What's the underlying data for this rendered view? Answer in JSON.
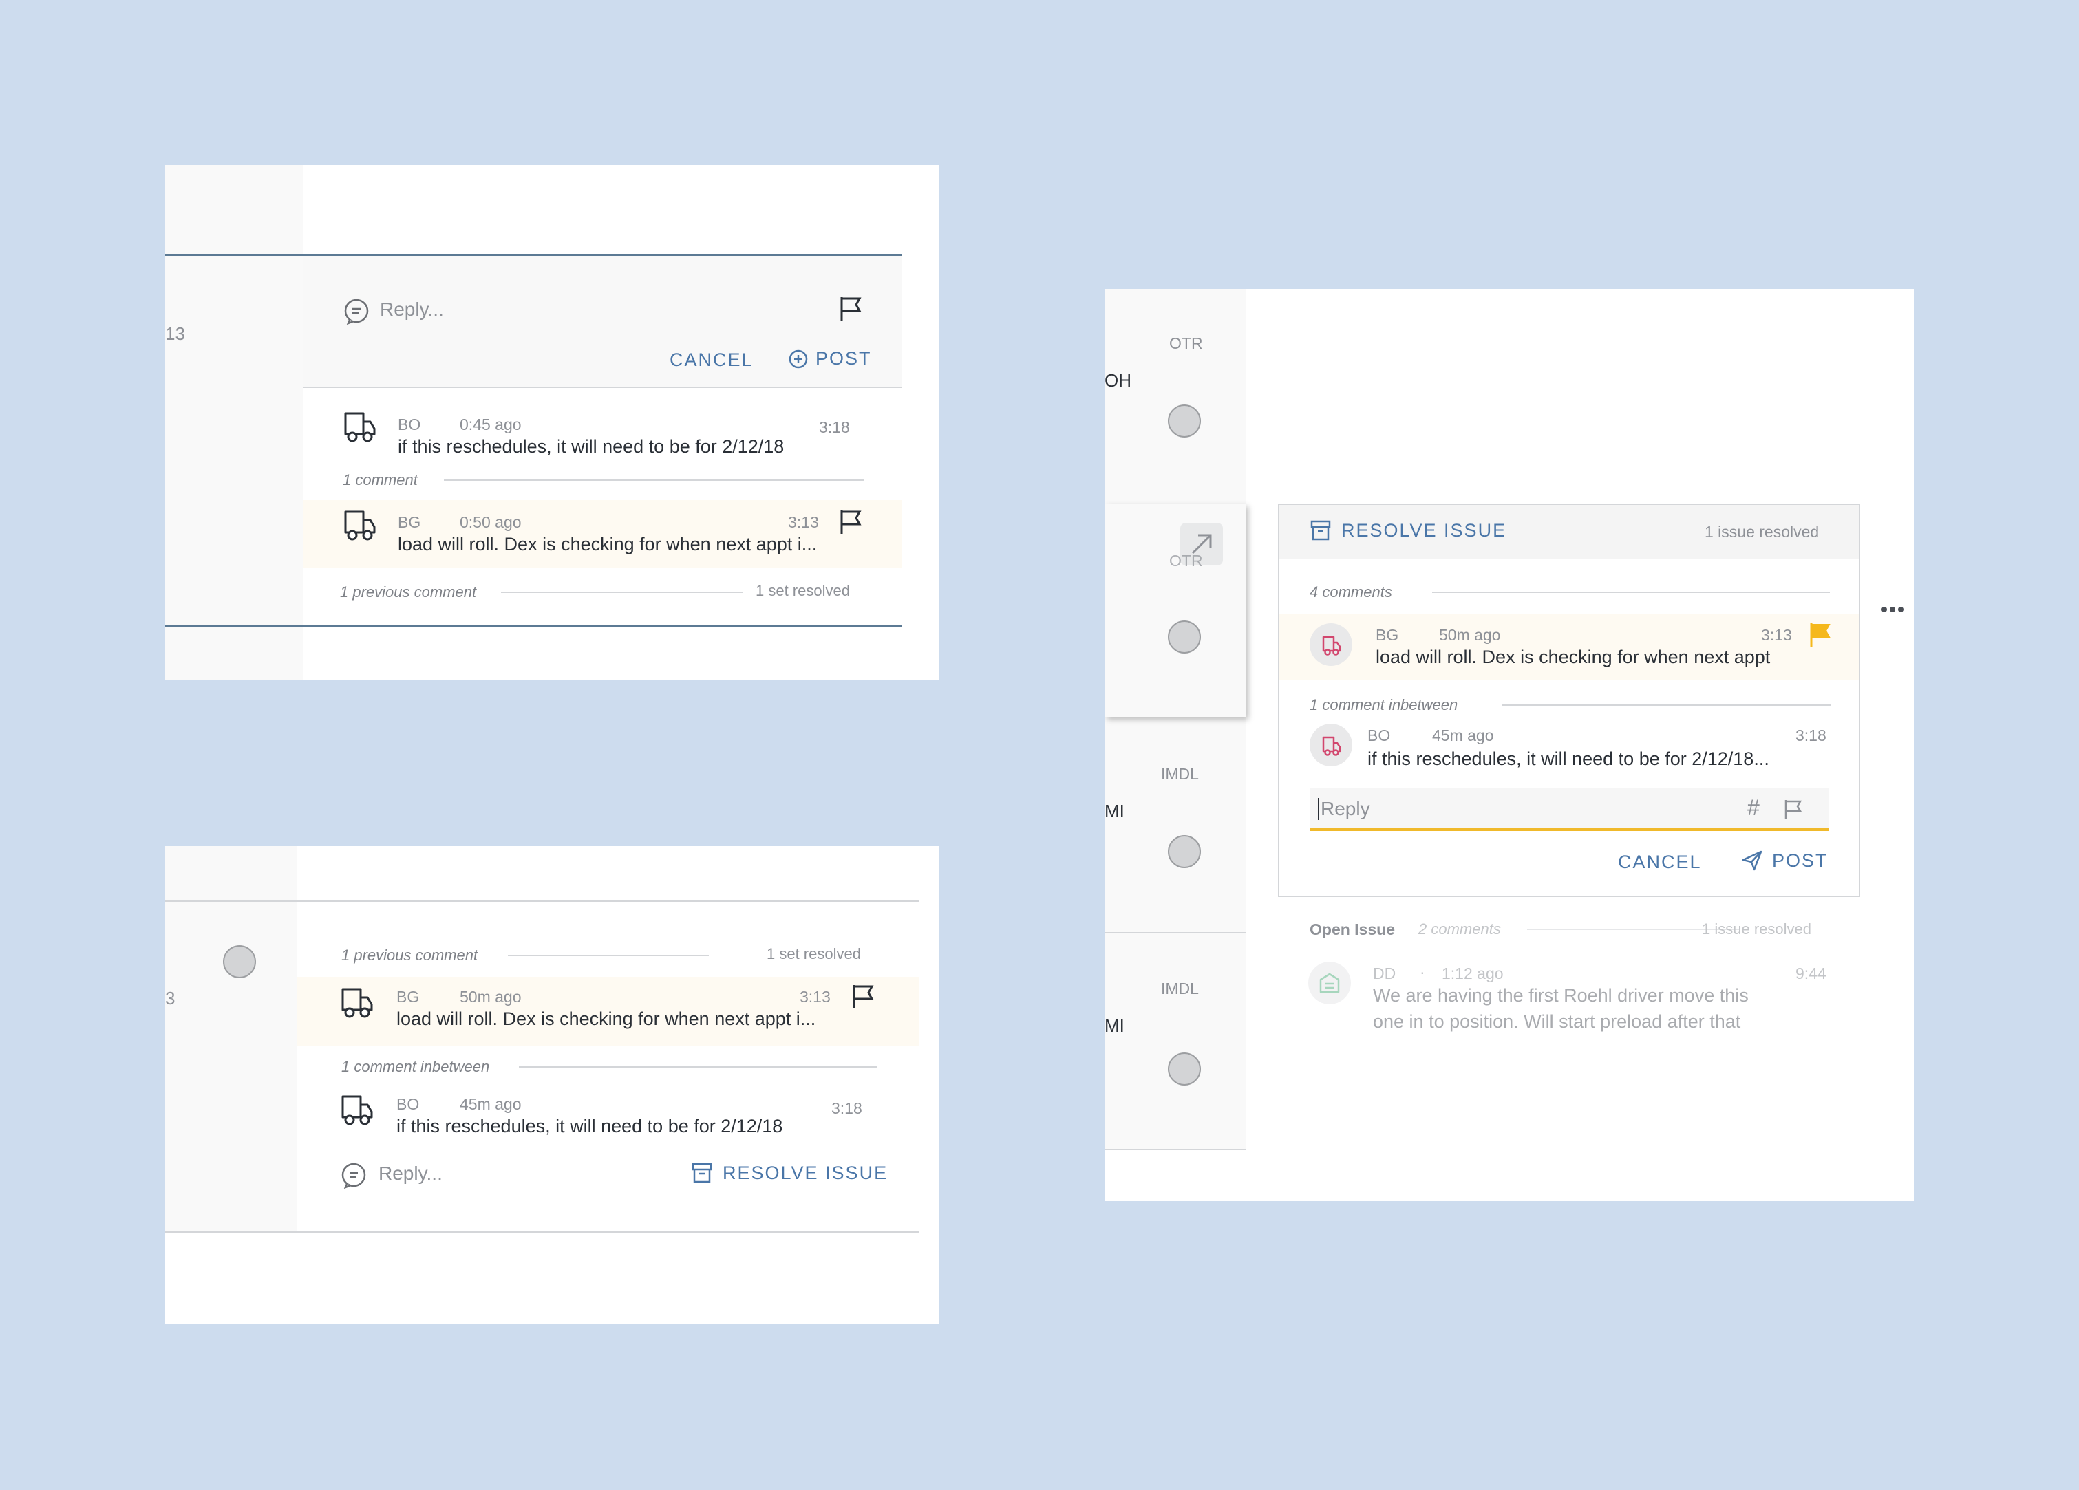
{
  "colors": {
    "background": "#cddcee",
    "accent_blue": "#4a76a8",
    "highlight_row": "#fefaf2",
    "flag_yellow": "#f5b81c",
    "avatar_pink": "#d2476e",
    "input_underline": "#f0b92b"
  },
  "panel1": {
    "left_fragment": "13",
    "reply_placeholder": "Reply...",
    "cancel_label": "CANCEL",
    "post_label": "POST",
    "comment1": {
      "author": "BO",
      "time_ago": "0:45 ago",
      "text": "if this reschedules, it will need to be for 2/12/18",
      "time": "3:18"
    },
    "divider_label": "1 comment",
    "comment2": {
      "author": "BG",
      "time_ago": "0:50 ago",
      "text": "load will roll.  Dex is checking for when next appt i...",
      "time": "3:13"
    },
    "footer_left": "1 previous comment",
    "footer_right": "1 set resolved"
  },
  "panel2": {
    "left_fragment": "3",
    "header_left": "1 previous comment",
    "header_right": "1 set resolved",
    "comment1": {
      "author": "BG",
      "time_ago": "50m ago",
      "text": "load will roll.  Dex is checking for when next appt i...",
      "time": "3:13"
    },
    "divider_label": "1 comment inbetween",
    "comment2": {
      "author": "BO",
      "time_ago": "45m ago",
      "text": "if this reschedules, it will need to be for 2/12/18",
      "time": "3:18"
    },
    "reply_placeholder": "Reply...",
    "resolve_label": "RESOLVE ISSUE"
  },
  "panel3": {
    "sidebar": [
      {
        "tag": "OTR",
        "fragment": "OH"
      },
      {
        "tag": "OTR",
        "fragment": ""
      },
      {
        "tag": "IMDL",
        "fragment": "MI"
      },
      {
        "tag": "IMDL",
        "fragment": "MI"
      }
    ],
    "card": {
      "resolve_label": "RESOLVE ISSUE",
      "resolved_count": "1 issue resolved",
      "comments_count": "4 comments",
      "comment1": {
        "author": "BG",
        "time_ago": "50m ago",
        "text": "load will roll.  Dex is checking for when next appt",
        "time": "3:13"
      },
      "divider_label": "1 comment inbetween",
      "comment2": {
        "author": "BO",
        "time_ago": "45m ago",
        "text": "if this reschedules, it will need to be for 2/12/18...",
        "time": "3:18"
      },
      "reply_placeholder": "Reply",
      "hash_symbol": "#",
      "cancel_label": "CANCEL",
      "post_label": "POST"
    },
    "open_issue": {
      "title": "Open Issue",
      "comments": "2 comments",
      "resolved": "1 issue resolved",
      "author": "DD",
      "separator": "·",
      "time_ago": "1:12 ago",
      "time": "9:44",
      "text_line1": "We are having the first Roehl driver move this",
      "text_line2": "one in to position.  Will start preload after that"
    }
  },
  "icons": [
    "truck-icon",
    "chat-bubble-icon",
    "flag-icon",
    "plus-circle-icon",
    "archive-icon",
    "send-icon",
    "expand-arrow-icon",
    "more-dots-icon",
    "hash-icon",
    "building-icon"
  ]
}
